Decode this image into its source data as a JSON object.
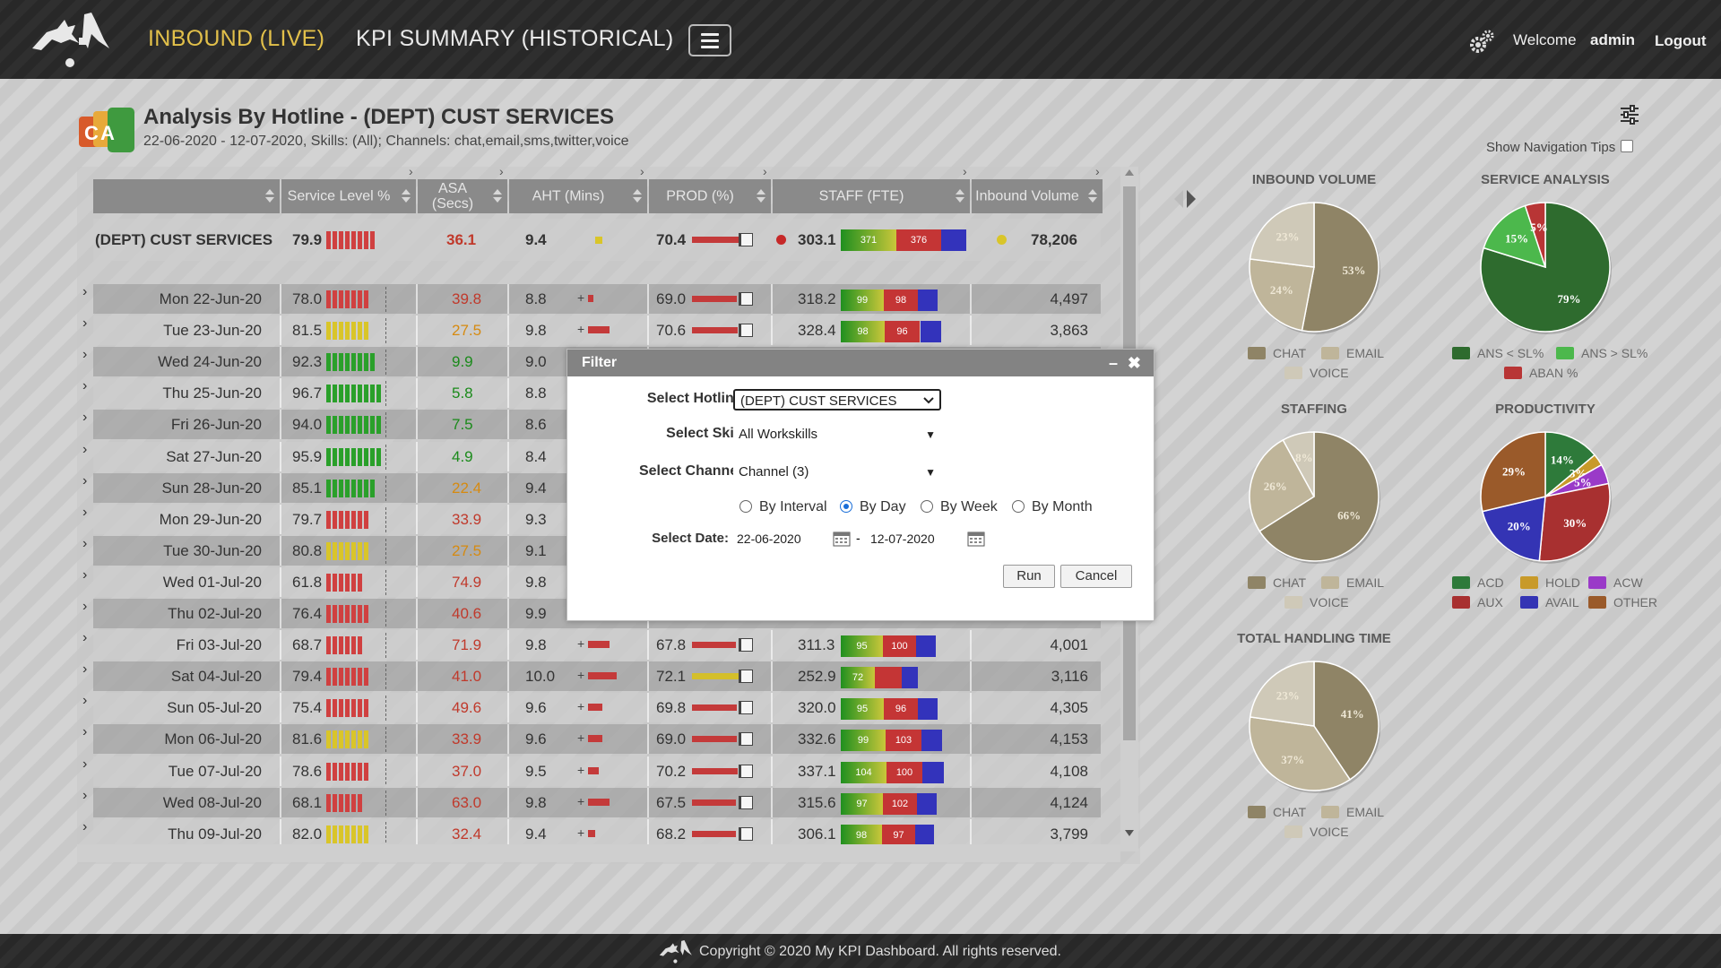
{
  "nav": {
    "live": "INBOUND (LIVE)",
    "historical": "KPI SUMMARY (HISTORICAL)",
    "welcome": "Welcome",
    "user": "admin",
    "logout": "Logout"
  },
  "header": {
    "title": "Analysis By Hotline - (DEPT) CUST SERVICES",
    "subtitle": "22-06-2020 - 12-07-2020, Skills: (All); Channels: chat,email,sms,twitter,voice",
    "nav_tips": "Show Navigation Tips"
  },
  "table": {
    "columns": [
      "Service Level %",
      "ASA (Secs)",
      "AHT (Mins)",
      "PROD (%)",
      "STAFF (FTE)",
      "Inbound Volume"
    ],
    "summary": {
      "name": "(DEPT) CUST SERVICES",
      "sl": "79.9",
      "asa": "36.1",
      "aht": "9.4",
      "prod": "70.4",
      "staff": "303.1",
      "staff_green": "371",
      "staff_red": "376",
      "volume": "78,206"
    },
    "rows": [
      {
        "date": "Mon 22-Jun-20",
        "sl": "78.0",
        "asa": "39.8",
        "aht": "8.8",
        "prod": "69.0",
        "staff": "318.2",
        "g": "99",
        "r": "98",
        "vol": "4,497"
      },
      {
        "date": "Tue 23-Jun-20",
        "sl": "81.5",
        "asa": "27.5",
        "aht": "9.8",
        "prod": "70.6",
        "staff": "328.4",
        "g": "98",
        "r": "96",
        "vol": "3,863"
      },
      {
        "date": "Wed 24-Jun-20",
        "sl": "92.3",
        "asa": "9.9",
        "aht": "9.0"
      },
      {
        "date": "Thu 25-Jun-20",
        "sl": "96.7",
        "asa": "5.8",
        "aht": "8.8"
      },
      {
        "date": "Fri 26-Jun-20",
        "sl": "94.0",
        "asa": "7.5",
        "aht": "8.6"
      },
      {
        "date": "Sat 27-Jun-20",
        "sl": "95.9",
        "asa": "4.9",
        "aht": "8.4"
      },
      {
        "date": "Sun 28-Jun-20",
        "sl": "85.1",
        "asa": "22.4",
        "aht": "9.4"
      },
      {
        "date": "Mon 29-Jun-20",
        "sl": "79.7",
        "asa": "33.9",
        "aht": "9.3"
      },
      {
        "date": "Tue 30-Jun-20",
        "sl": "80.8",
        "asa": "27.5",
        "aht": "9.1"
      },
      {
        "date": "Wed 01-Jul-20",
        "sl": "61.8",
        "asa": "74.9",
        "aht": "9.8"
      },
      {
        "date": "Thu 02-Jul-20",
        "sl": "76.4",
        "asa": "40.6",
        "aht": "9.9"
      },
      {
        "date": "Fri 03-Jul-20",
        "sl": "68.7",
        "asa": "71.9",
        "aht": "9.8",
        "prod": "67.8",
        "staff": "311.3",
        "g": "95",
        "r": "100",
        "vol": "4,001"
      },
      {
        "date": "Sat 04-Jul-20",
        "sl": "79.4",
        "asa": "41.0",
        "aht": "10.0",
        "prod": "72.1",
        "staff": "252.9",
        "g": "72",
        "r": "",
        "vol": "3,116"
      },
      {
        "date": "Sun 05-Jul-20",
        "sl": "75.4",
        "asa": "49.6",
        "aht": "9.6",
        "prod": "69.8",
        "staff": "320.0",
        "g": "95",
        "r": "96",
        "vol": "4,305"
      },
      {
        "date": "Mon 06-Jul-20",
        "sl": "81.6",
        "asa": "33.9",
        "aht": "9.6",
        "prod": "69.0",
        "staff": "332.6",
        "g": "99",
        "r": "103",
        "vol": "4,153"
      },
      {
        "date": "Tue 07-Jul-20",
        "sl": "78.6",
        "asa": "37.0",
        "aht": "9.5",
        "prod": "70.2",
        "staff": "337.1",
        "g": "104",
        "r": "100",
        "vol": "4,108"
      },
      {
        "date": "Wed 08-Jul-20",
        "sl": "68.1",
        "asa": "63.0",
        "aht": "9.8",
        "prod": "67.5",
        "staff": "315.6",
        "g": "97",
        "r": "102",
        "vol": "4,124"
      },
      {
        "date": "Thu 09-Jul-20",
        "sl": "82.0",
        "asa": "32.4",
        "aht": "9.4",
        "prod": "68.2",
        "staff": "306.1",
        "g": "98",
        "r": "97",
        "vol": "3,799"
      }
    ]
  },
  "charts": {
    "inbound_volume": {
      "title": "INBOUND VOLUME",
      "slices": [
        {
          "label": "CHAT",
          "value": 53
        },
        {
          "label": "EMAIL",
          "value": 24
        },
        {
          "label": "VOICE",
          "value": 23
        }
      ],
      "legend": [
        "CHAT",
        "EMAIL",
        "VOICE"
      ]
    },
    "service_analysis": {
      "title": "SERVICE ANALYSIS",
      "slices": [
        {
          "label": "ANS < SL%",
          "value": 79
        },
        {
          "label": "ANS > SL%",
          "value": 15
        },
        {
          "label": "ABAN %",
          "value": 5
        }
      ],
      "legend": [
        "ANS < SL%",
        "ANS > SL%",
        "ABAN %"
      ]
    },
    "staffing": {
      "title": "STAFFING",
      "slices": [
        {
          "label": "CHAT",
          "value": 66
        },
        {
          "label": "EMAIL",
          "value": 26
        },
        {
          "label": "VOICE",
          "value": 8
        }
      ],
      "legend": [
        "CHAT",
        "EMAIL",
        "VOICE"
      ]
    },
    "productivity": {
      "title": "PRODUCTIVITY",
      "slices": [
        {
          "label": "ACD",
          "value": 14
        },
        {
          "label": "HOLD",
          "value": 3
        },
        {
          "label": "ACW",
          "value": 5
        },
        {
          "label": "AUX",
          "value": 30
        },
        {
          "label": "AVAIL",
          "value": 20
        },
        {
          "label": "OTHER",
          "value": 29
        }
      ],
      "legend": [
        "ACD",
        "HOLD",
        "ACW",
        "AUX",
        "AVAIL",
        "OTHER"
      ]
    },
    "handling_time": {
      "title": "TOTAL HANDLING TIME",
      "slices": [
        {
          "label": "CHAT",
          "value": 41
        },
        {
          "label": "EMAIL",
          "value": 37
        },
        {
          "label": "VOICE",
          "value": 23
        }
      ],
      "legend": [
        "CHAT",
        "EMAIL",
        "VOICE"
      ]
    }
  },
  "filter": {
    "title": "Filter",
    "hotline_label": "Select Hotline:",
    "hotline_value": "(DEPT) CUST SERVICES",
    "skill_label": "Select Skill:",
    "skill_value": "All Workskills",
    "channel_label": "Select Channel:",
    "channel_value": "Channel (3)",
    "radios": [
      "By Interval",
      "By Day",
      "By Week",
      "By Month"
    ],
    "selected_radio": "By Day",
    "date_label": "Select Date:",
    "date_from": "22-06-2020",
    "date_to": "12-07-2020",
    "date_sep": "-",
    "run": "Run",
    "cancel": "Cancel"
  },
  "footer": {
    "copyright": "Copyright © 2020 My KPI Dashboard. All rights reserved."
  },
  "colors": {
    "accent_gold": "#e2c04a",
    "green": "#1f8f1f",
    "red": "#c43535",
    "blue": "#3333bb",
    "yellow": "#d4bf2a"
  }
}
